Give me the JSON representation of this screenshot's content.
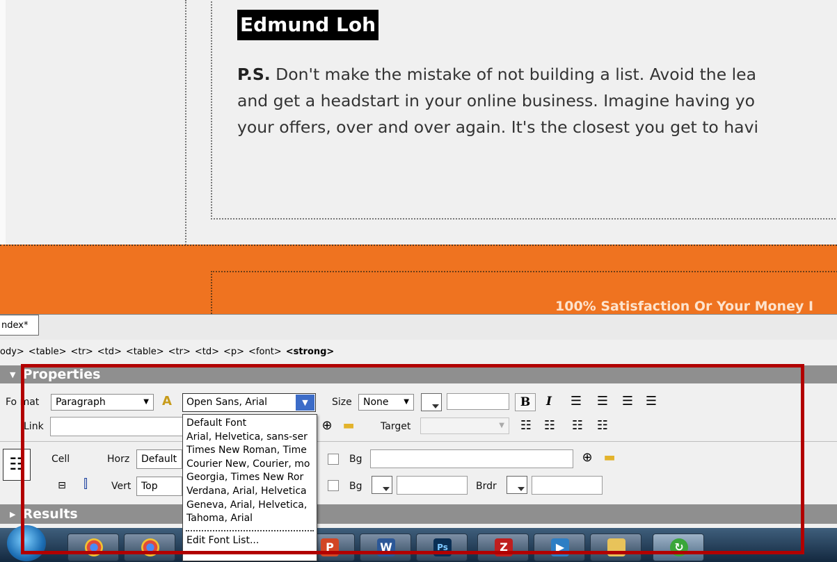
{
  "design": {
    "signature": "Edmund Loh",
    "ps_lead": "P.S.",
    "ps_lines": [
      " Don't make the mistake of not building a list. Avoid the lea",
      "and get a headstart in your online business. Imagine having yo",
      "your offers, over and over again. It's the closest you get to havi"
    ],
    "guarantee": "100% Satisfaction Or Your Money I"
  },
  "document_tab": "ndex*",
  "tag_selector": [
    "ody>",
    "<table>",
    "<tr>",
    "<td>",
    "<table>",
    "<tr>",
    "<td>",
    "<p>",
    "<font>"
  ],
  "tag_selector_current": "<strong>",
  "properties": {
    "title": "Properties",
    "format_label": "Fo    mat",
    "format_value": "Paragraph",
    "font_value": "Open Sans, Arial",
    "size_label": "Size",
    "size_value": "None",
    "bold": "B",
    "italic": "I",
    "link_label": "Link",
    "target_label": "Target",
    "cell_label": "Cell",
    "horz_label": "Horz",
    "horz_value": "Default",
    "vert_label": "Vert",
    "vert_value": "Top",
    "bg_label": "Bg",
    "bg2_label": "Bg",
    "brdr_label": "Brdr"
  },
  "font_list": {
    "options": [
      "Default Font",
      "Arial, Helvetica, sans-ser",
      "Times New Roman, Time",
      "Courier New, Courier, mo",
      "Georgia, Times New Ror",
      "Verdana, Arial, Helvetica",
      "Geneva, Arial, Helvetica,",
      "Tahoma, Arial"
    ],
    "edit": "Edit Font List..."
  },
  "results": {
    "title": "Results"
  },
  "colors": {
    "orange": "#ef7320",
    "annotation": "#b20000",
    "panel_header": "#8f8f8f"
  },
  "taskbar_apps": [
    "start-orb",
    "chrome",
    "chrome",
    "powerpoint",
    "word",
    "photoshop",
    "filezilla",
    "media-player",
    "explorer",
    "dreamweaver"
  ]
}
